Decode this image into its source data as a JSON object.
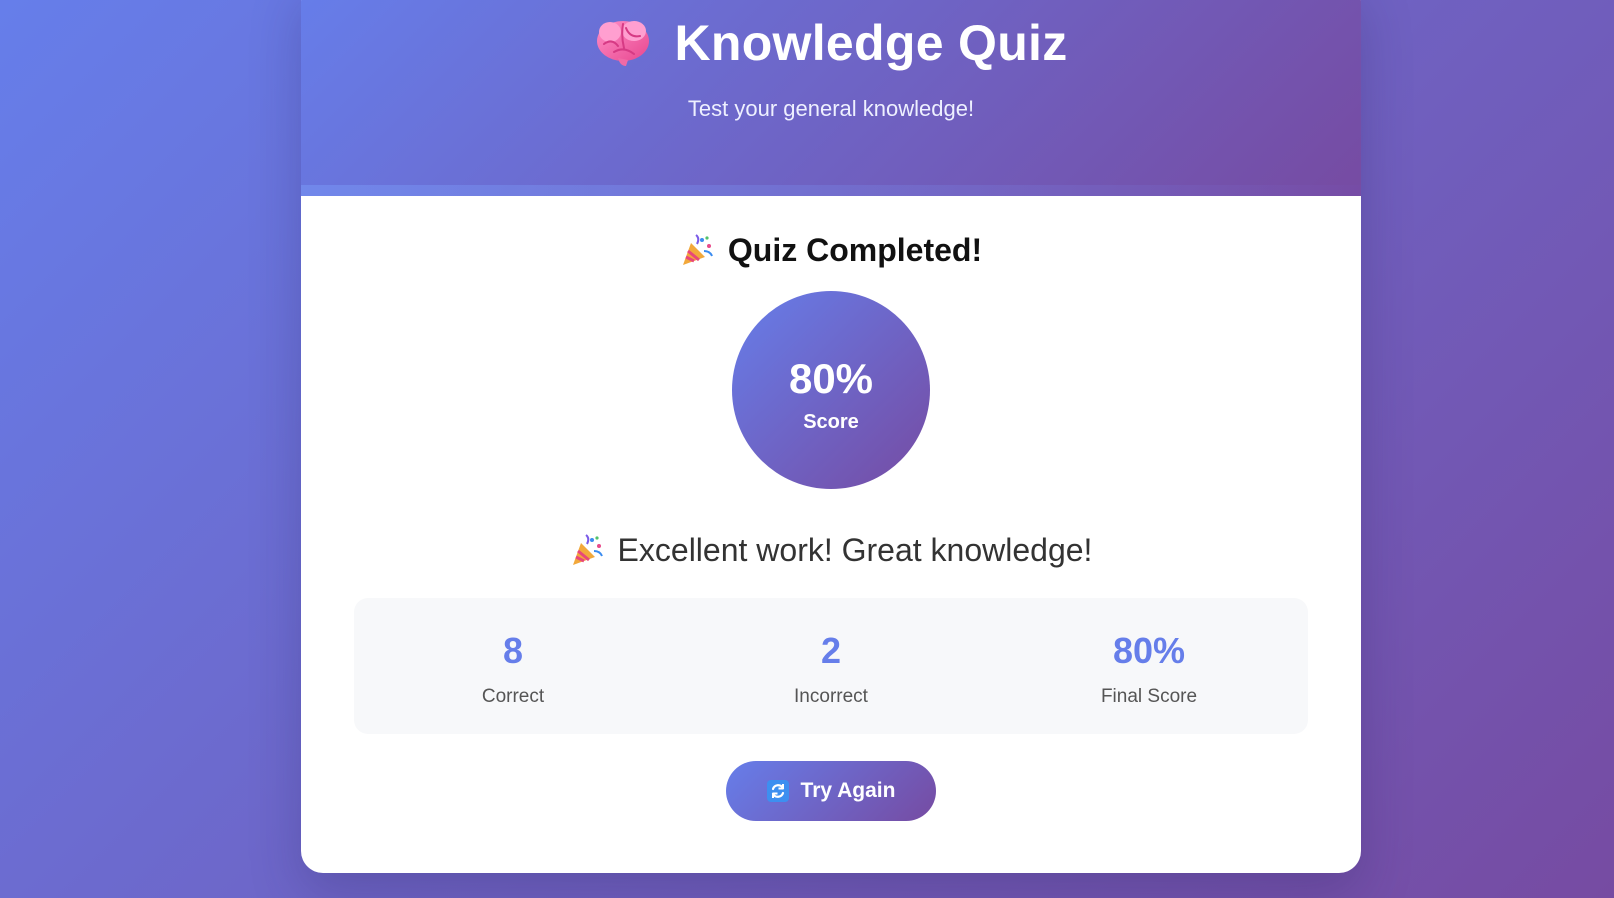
{
  "header": {
    "title": "Knowledge Quiz",
    "subtitle": "Test your general knowledge!",
    "icon": "brain-icon"
  },
  "result": {
    "heading": "Quiz Completed!",
    "heading_icon": "party-popper-icon",
    "score_value": "80%",
    "score_label": "Score",
    "message": "Excellent work! Great knowledge!",
    "message_icon": "party-popper-icon"
  },
  "stats": [
    {
      "value": "8",
      "label": "Correct"
    },
    {
      "value": "2",
      "label": "Incorrect"
    },
    {
      "value": "80%",
      "label": "Final Score"
    }
  ],
  "actions": {
    "try_again_label": "Try Again",
    "try_again_icon": "refresh-icon"
  },
  "colors": {
    "gradient_start": "#667eea",
    "gradient_end": "#764ba2",
    "accent": "#667eea"
  }
}
